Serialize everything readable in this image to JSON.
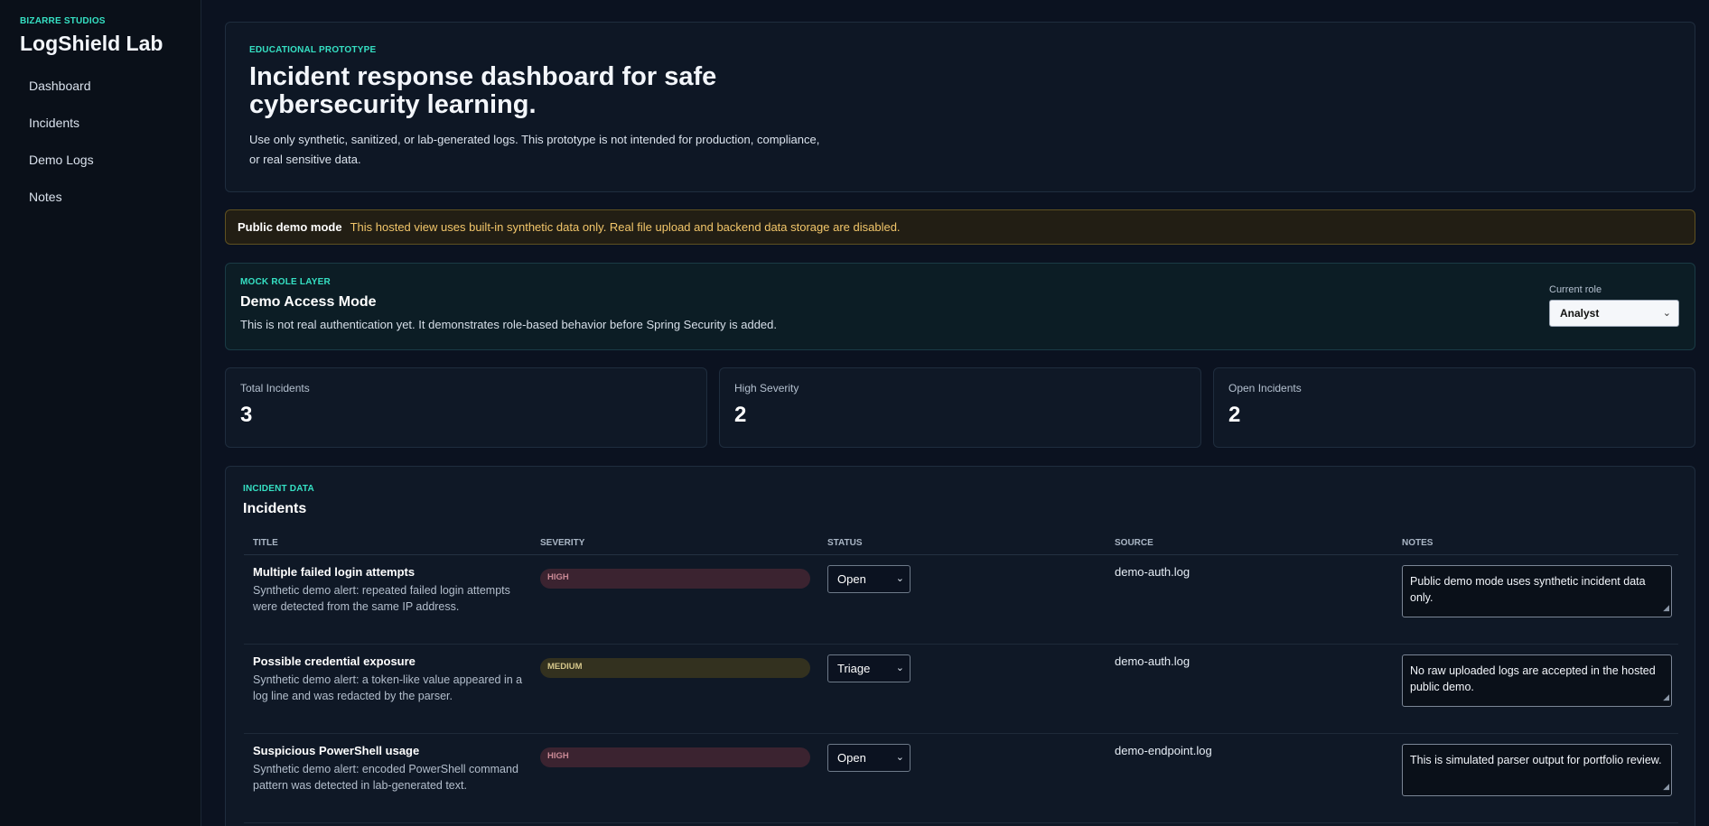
{
  "sidebar": {
    "brand_small": "BIZARRE STUDIOS",
    "brand_title": "LogShield Lab",
    "items": [
      {
        "label": "Dashboard"
      },
      {
        "label": "Incidents"
      },
      {
        "label": "Demo Logs"
      },
      {
        "label": "Notes"
      }
    ]
  },
  "hero": {
    "eyebrow": "EDUCATIONAL PROTOTYPE",
    "title": "Incident response dashboard for safe cybersecurity learning.",
    "text": "Use only synthetic, sanitized, or lab-generated logs. This prototype is not intended for production, compliance, or real sensitive data."
  },
  "banner": {
    "strong": "Public demo mode",
    "text": "This hosted view uses built-in synthetic data only. Real file upload and backend data storage are disabled."
  },
  "role": {
    "eyebrow": "MOCK ROLE LAYER",
    "title": "Demo Access Mode",
    "text": "This is not real authentication yet. It demonstrates role-based behavior before Spring Security is added.",
    "select_label": "Current role",
    "selected": "Analyst"
  },
  "stats": [
    {
      "label": "Total Incidents",
      "value": "3"
    },
    {
      "label": "High Severity",
      "value": "2"
    },
    {
      "label": "Open Incidents",
      "value": "2"
    }
  ],
  "incidents": {
    "eyebrow": "INCIDENT DATA",
    "title": "Incidents",
    "columns": [
      "TITLE",
      "SEVERITY",
      "STATUS",
      "SOURCE",
      "NOTES"
    ],
    "rows": [
      {
        "title": "Multiple failed login attempts",
        "desc": "Synthetic demo alert: repeated failed login attempts were detected from the same IP address.",
        "severity": "HIGH",
        "status": "Open",
        "source": "demo-auth.log",
        "notes": "Public demo mode uses synthetic incident data only."
      },
      {
        "title": "Possible credential exposure",
        "desc": "Synthetic demo alert: a token-like value appeared in a log line and was redacted by the parser.",
        "severity": "MEDIUM",
        "status": "Triage",
        "source": "demo-auth.log",
        "notes": "No raw uploaded logs are accepted in the hosted public demo."
      },
      {
        "title": "Suspicious PowerShell usage",
        "desc": "Synthetic demo alert: encoded PowerShell command pattern was detected in lab-generated text.",
        "severity": "HIGH",
        "status": "Open",
        "source": "demo-endpoint.log",
        "notes": "This is simulated parser output for portfolio review."
      }
    ]
  },
  "icons": {
    "select_chevron": "chevron-down-icon",
    "textarea_resize": "resize-grip-icon"
  },
  "colors": {
    "accent": "#35e0c3",
    "high": "#c98995",
    "medium": "#d6c78b",
    "warning_text": "#f2c66a"
  }
}
